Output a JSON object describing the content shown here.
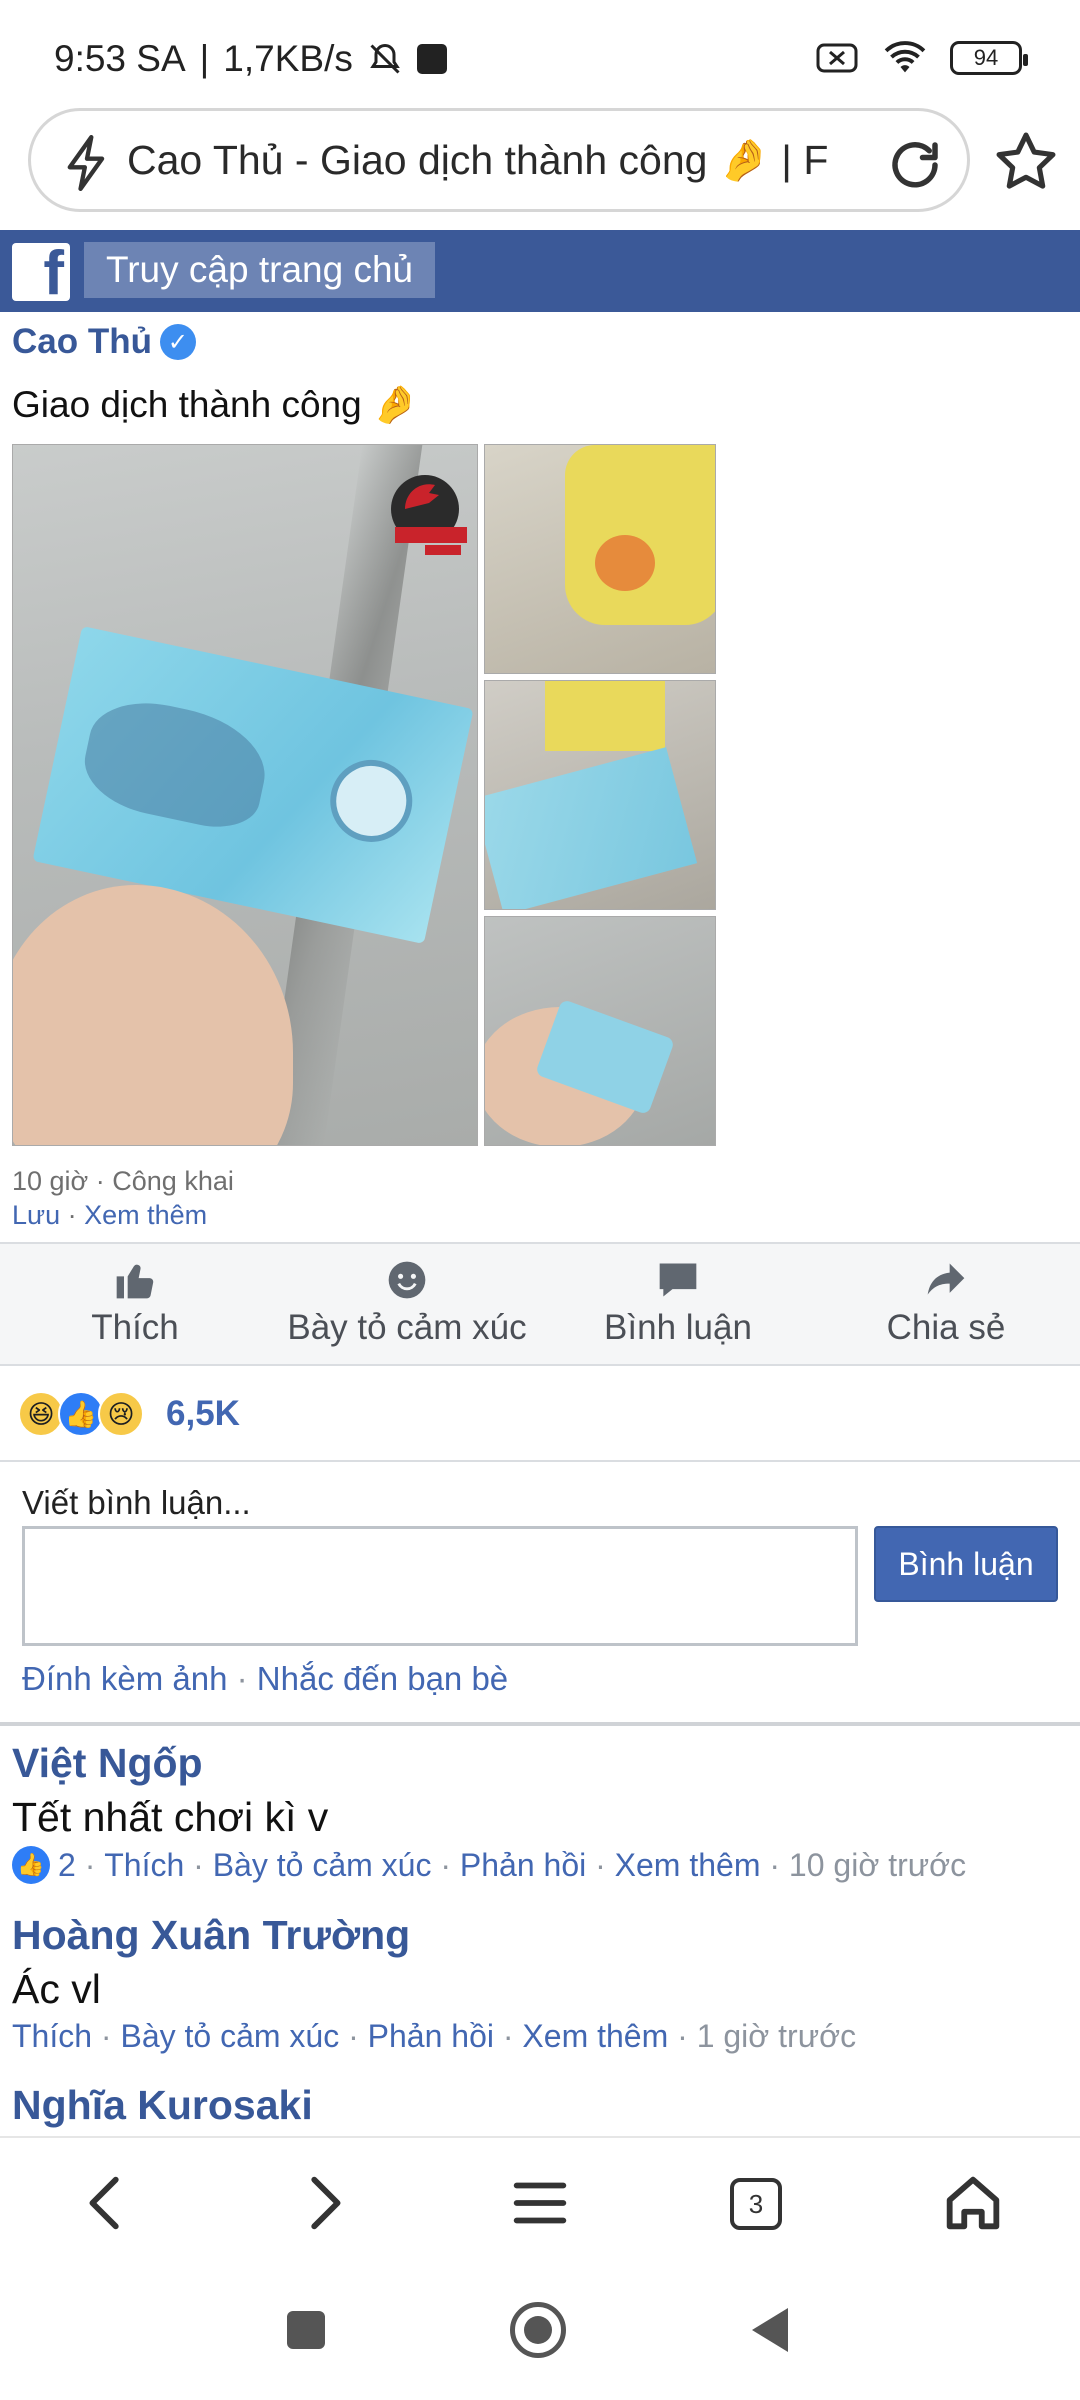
{
  "status": {
    "time": "9:53 SA",
    "network_speed": "1,7KB/s",
    "battery": "94"
  },
  "browser": {
    "url_title": "Cao Thủ - Giao dịch thành công 🤌 | F",
    "tabs_count": "3"
  },
  "fb": {
    "logo": "f",
    "home_link": "Truy cập trang chủ"
  },
  "post": {
    "author": "Cao Thủ",
    "text": "Giao dịch thành công 🤌",
    "time": "10 giờ",
    "visibility": "Công khai",
    "save": "Lưu",
    "see_more": "Xem thêm"
  },
  "actions": {
    "like": "Thích",
    "react": "Bày tỏ cảm xúc",
    "comment": "Bình luận",
    "share": "Chia sẻ"
  },
  "reactions": {
    "count": "6,5K",
    "emojis": [
      "😆",
      "👍",
      "😢"
    ]
  },
  "comment_box": {
    "label": "Viết bình luận...",
    "submit": "Bình luận",
    "attach_photo": "Đính kèm ảnh",
    "mention": "Nhắc đến bạn bè"
  },
  "comments": [
    {
      "name": "Việt Ngốp",
      "text": "Tết nhất chơi kì v",
      "likes": "2",
      "like": "Thích",
      "react": "Bày tỏ cảm xúc",
      "reply": "Phản hồi",
      "more": "Xem thêm",
      "time": "10 giờ trước"
    },
    {
      "name": "Hoàng Xuân Trường",
      "text": "Ác vl",
      "like": "Thích",
      "react": "Bày tỏ cảm xúc",
      "reply": "Phản hồi",
      "more": "Xem thêm",
      "time": "1 giờ trước"
    },
    {
      "name": "Nghĩa Kurosaki"
    }
  ],
  "colors": {
    "fb_blue": "#3b5998",
    "link_blue": "#4267b2"
  }
}
